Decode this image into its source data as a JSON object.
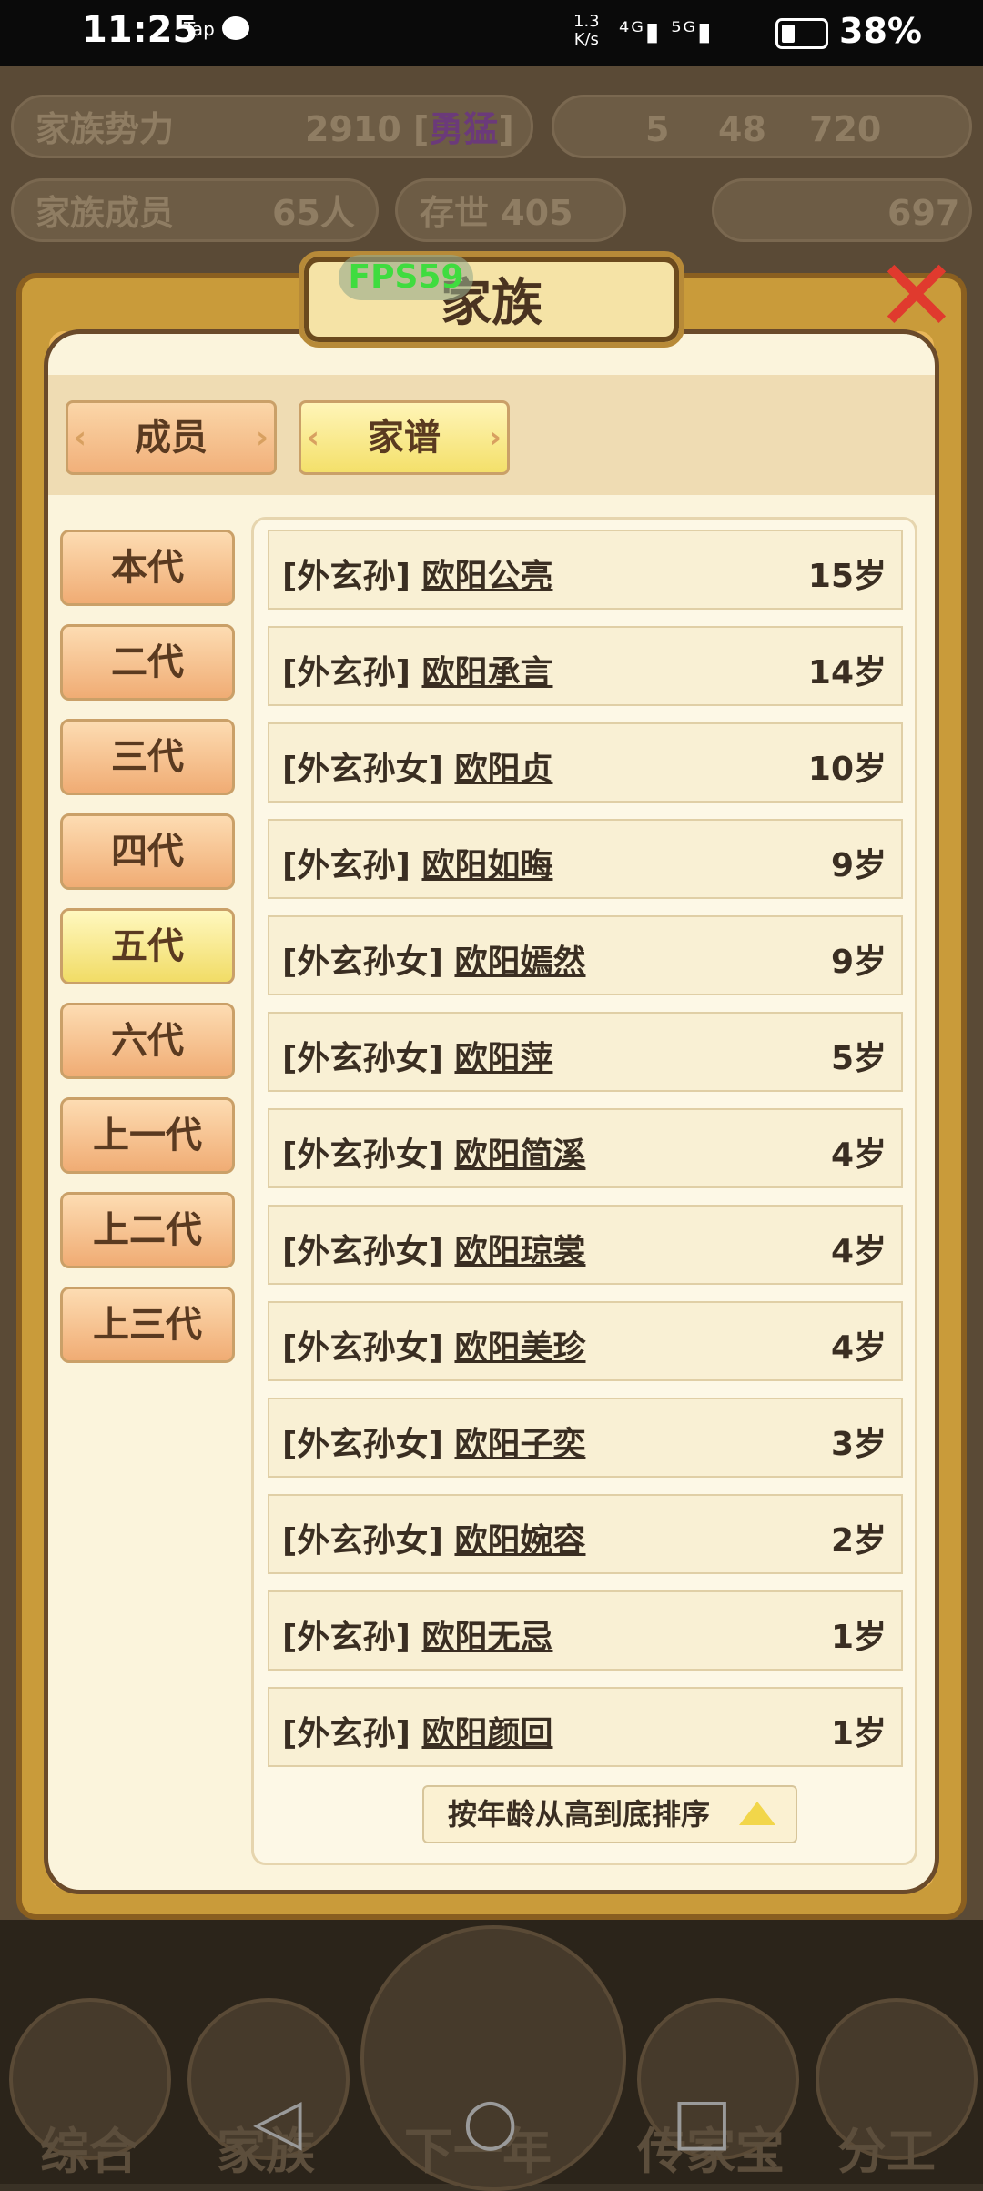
{
  "status_bar": {
    "time": "11:25",
    "tap_label": "Tap",
    "net_speed_top": "1.3",
    "net_speed_bottom": "K/s",
    "signal_icons": "⁴ᴳ▮ ⁵ᴳ▮",
    "battery": "38%"
  },
  "background": {
    "power_label": "家族势力",
    "power_value": "2910 [",
    "power_rank": "勇猛",
    "power_end": "]",
    "currency_a": "5",
    "currency_b": "48",
    "currency_c": "720",
    "members_label": "家族成员",
    "members_value": "65人",
    "survive_label": "存世 405年",
    "gold_value": "697",
    "nav": [
      "综合",
      "家族",
      "下一年",
      "传家宝",
      "分工"
    ]
  },
  "dialog": {
    "title": "家族",
    "fps": "FPS59",
    "close_icon": "x-close-icon",
    "tabs": [
      {
        "label": "成员",
        "active": false
      },
      {
        "label": "家谱",
        "active": true
      }
    ],
    "generations": [
      {
        "label": "本代",
        "active": false
      },
      {
        "label": "二代",
        "active": false
      },
      {
        "label": "三代",
        "active": false
      },
      {
        "label": "四代",
        "active": false
      },
      {
        "label": "五代",
        "active": true
      },
      {
        "label": "六代",
        "active": false
      },
      {
        "label": "上一代",
        "active": false
      },
      {
        "label": "上二代",
        "active": false
      },
      {
        "label": "上三代",
        "active": false
      }
    ],
    "members": [
      {
        "relation": "[外玄孙]",
        "name": "欧阳公亮",
        "age": "15岁"
      },
      {
        "relation": "[外玄孙]",
        "name": "欧阳承言",
        "age": "14岁"
      },
      {
        "relation": "[外玄孙女]",
        "name": "欧阳贞",
        "age": "10岁"
      },
      {
        "relation": "[外玄孙]",
        "name": "欧阳如晦",
        "age": "9岁"
      },
      {
        "relation": "[外玄孙女]",
        "name": "欧阳嫣然",
        "age": "9岁"
      },
      {
        "relation": "[外玄孙女]",
        "name": "欧阳萍",
        "age": "5岁"
      },
      {
        "relation": "[外玄孙女]",
        "name": "欧阳简溪",
        "age": "4岁"
      },
      {
        "relation": "[外玄孙女]",
        "name": "欧阳琼裳",
        "age": "4岁"
      },
      {
        "relation": "[外玄孙女]",
        "name": "欧阳美珍",
        "age": "4岁"
      },
      {
        "relation": "[外玄孙女]",
        "name": "欧阳子奕",
        "age": "3岁"
      },
      {
        "relation": "[外玄孙女]",
        "name": "欧阳婉容",
        "age": "2岁"
      },
      {
        "relation": "[外玄孙]",
        "name": "欧阳无忌",
        "age": "1岁"
      },
      {
        "relation": "[外玄孙]",
        "name": "欧阳颜回",
        "age": "1岁"
      }
    ],
    "sort_label": "按年龄从高到底排序"
  }
}
